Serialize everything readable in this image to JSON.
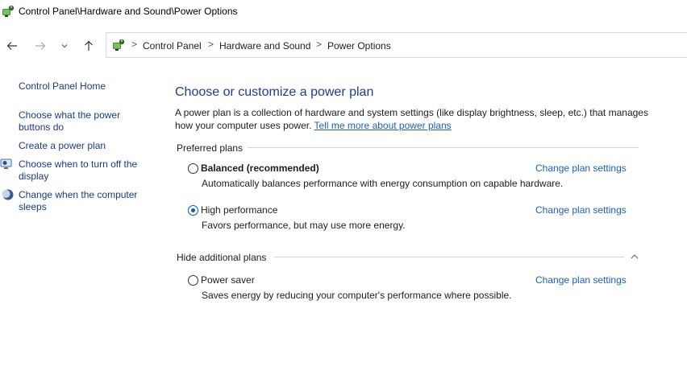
{
  "window": {
    "title": "Control Panel\\Hardware and Sound\\Power Options"
  },
  "nav": {
    "back_icon": "back-arrow-icon",
    "forward_icon": "forward-arrow-icon",
    "recent_icon": "chevron-down-icon",
    "up_icon": "up-arrow-icon"
  },
  "breadcrumb": {
    "items": [
      "Control Panel",
      "Hardware and Sound",
      "Power Options"
    ],
    "separator": ">"
  },
  "sidebar": {
    "home": "Control Panel Home",
    "links": [
      "Choose what the power buttons do",
      "Create a power plan",
      "Choose when to turn off the display",
      "Change when the computer sleeps"
    ]
  },
  "main": {
    "heading": "Choose or customize a power plan",
    "description": "A power plan is a collection of hardware and system settings (like display brightness, sleep, etc.) that manages how your computer uses power.",
    "description_link": "Tell me more about power plans",
    "preferred_label": "Preferred plans",
    "hide_label": "Hide additional plans",
    "change_settings": "Change plan settings",
    "plans": [
      {
        "name": "Balanced (recommended)",
        "desc": "Automatically balances performance with energy consumption on capable hardware.",
        "selected": false
      },
      {
        "name": "High performance",
        "desc": "Favors performance, but may use more energy.",
        "selected": true
      },
      {
        "name": "Power saver",
        "desc": "Saves energy by reducing your computer's performance where possible.",
        "selected": false
      }
    ]
  },
  "colors": {
    "link": "#1b5fbf",
    "heading": "#1f3d8f",
    "radio_selected": "#0a59c8"
  }
}
